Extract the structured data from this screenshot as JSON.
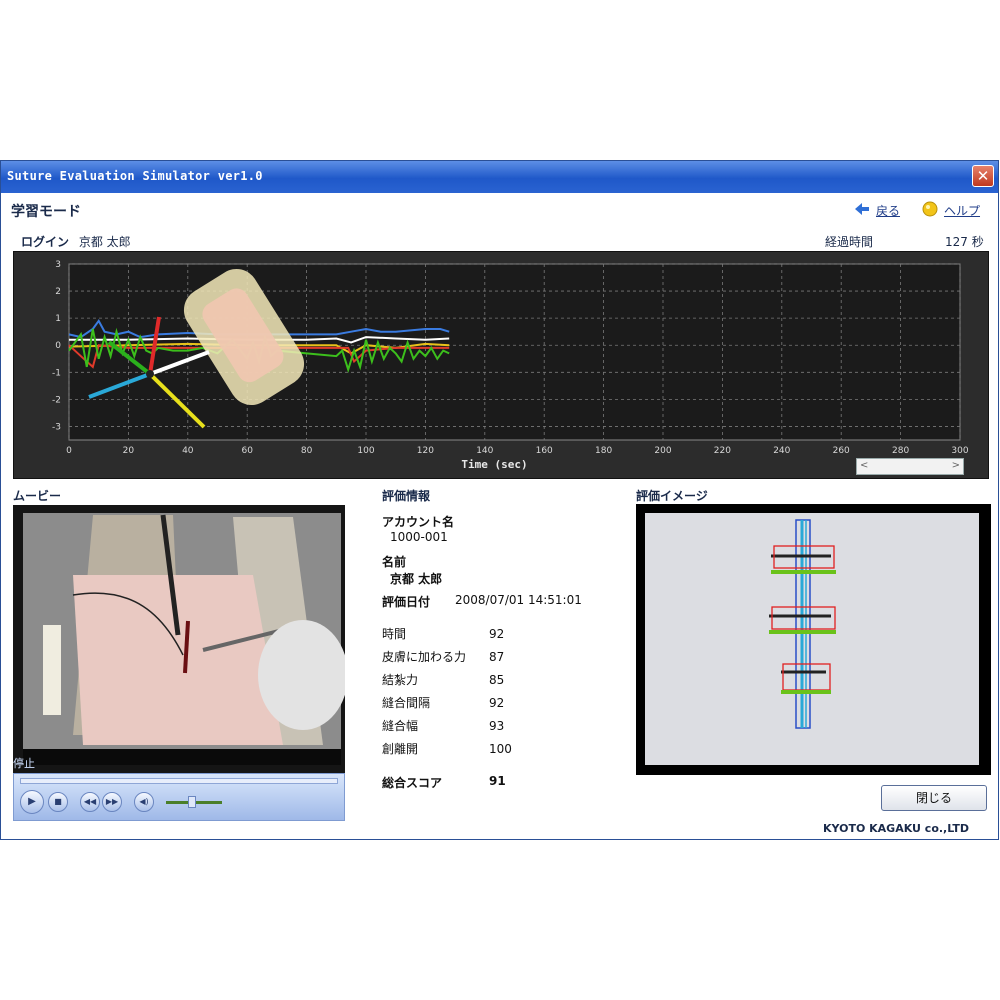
{
  "window": {
    "title": "Suture Evaluation Simulator ver1.0",
    "close_glyph": "✕"
  },
  "header": {
    "mode": "学習モード",
    "back_label": "戻る",
    "help_label": "ヘルプ"
  },
  "login": {
    "label": "ログイン",
    "user": "京都 太郎"
  },
  "elapsed": {
    "label": "経過時間",
    "value": "127 秒"
  },
  "chart_data": {
    "type": "line",
    "xlabel": "Time (sec)",
    "xlim": [
      0,
      300
    ],
    "ylim": [
      -3.5,
      3
    ],
    "xticks": [
      "0",
      "20",
      "40",
      "60",
      "80",
      "100",
      "120",
      "140",
      "160",
      "180",
      "200",
      "220",
      "240",
      "260",
      "280",
      "300"
    ],
    "yticks": [
      "3",
      "2",
      "1",
      "0",
      "-1",
      "-2",
      "-3"
    ],
    "grid": true,
    "series": [
      {
        "color": "#3a7be0",
        "x": [
          0,
          4,
          8,
          10,
          12,
          16,
          20,
          24,
          30,
          40,
          50,
          60,
          70,
          80,
          90,
          95,
          100,
          105,
          110,
          120,
          125,
          128
        ],
        "y": [
          0.4,
          0.3,
          0.6,
          0.9,
          0.5,
          0.4,
          0.5,
          0.3,
          0.4,
          0.45,
          0.4,
          0.4,
          0.4,
          0.4,
          0.4,
          0.5,
          0.6,
          0.5,
          0.5,
          0.6,
          0.6,
          0.5
        ]
      },
      {
        "color": "#ffffff",
        "x": [
          0,
          20,
          40,
          60,
          80,
          90,
          95,
          100,
          110,
          120,
          128
        ],
        "y": [
          0.2,
          0.2,
          0.25,
          0.2,
          0.2,
          0.25,
          0.1,
          0.3,
          0.25,
          0.2,
          0.25
        ]
      },
      {
        "color": "#e8c21a",
        "x": [
          0,
          20,
          40,
          60,
          80,
          90,
          95,
          100,
          110,
          120,
          128
        ],
        "y": [
          -0.05,
          0,
          0.05,
          0,
          0,
          0,
          -0.3,
          0,
          -0.1,
          0.05,
          0
        ]
      },
      {
        "color": "#e03a2a",
        "x": [
          0,
          5,
          8,
          10,
          20,
          40,
          60,
          80,
          94,
          96,
          100,
          110,
          120,
          128
        ],
        "y": [
          0,
          -0.5,
          -0.8,
          0,
          -0.1,
          -0.1,
          -0.1,
          -0.1,
          -0.1,
          -0.6,
          -0.2,
          -0.1,
          -0.1,
          -0.1
        ]
      },
      {
        "color": "#3cbf1c",
        "x": [
          0,
          4,
          6,
          8,
          10,
          12,
          14,
          16,
          18,
          20,
          22,
          24,
          26,
          28,
          30,
          35,
          40,
          45,
          50,
          55,
          60,
          62,
          64,
          66,
          68,
          70,
          80,
          90,
          92,
          94,
          96,
          98,
          100,
          102,
          104,
          106,
          108,
          110,
          112,
          114,
          116,
          118,
          120,
          122,
          124,
          126,
          128
        ],
        "y": [
          -0.2,
          0.4,
          -0.8,
          0.6,
          -0.5,
          0.3,
          -0.4,
          0.5,
          -0.3,
          0.2,
          -0.4,
          0.3,
          -0.2,
          -0.3,
          -0.1,
          -0.2,
          -0.2,
          -0.1,
          -0.3,
          0.2,
          -0.5,
          0.1,
          -0.6,
          0.3,
          -0.4,
          -0.2,
          -0.3,
          -0.4,
          -0.2,
          -0.9,
          -0.2,
          -0.8,
          0.2,
          -0.6,
          0.1,
          -0.5,
          -0.1,
          -0.3,
          -0.6,
          0.1,
          -0.5,
          -0.2,
          -0.4,
          -0.1,
          -0.5,
          -0.2,
          -0.3
        ]
      }
    ]
  },
  "movie": {
    "label": "ムービー",
    "status": "停止"
  },
  "evaluation": {
    "section_label": "評価情報",
    "account_label": "アカウント名",
    "account_value": "1000-001",
    "name_label": "名前",
    "name_value": "京都 太郎",
    "date_label": "評価日付",
    "date_value": "2008/07/01 14:51:01",
    "scores": [
      {
        "label": "時間",
        "value": "92"
      },
      {
        "label": "皮膚に加わる力",
        "value": "87"
      },
      {
        "label": "結紮力",
        "value": "85"
      },
      {
        "label": "縫合間隔",
        "value": "92"
      },
      {
        "label": "縫合幅",
        "value": "93"
      },
      {
        "label": "創離開",
        "value": "100"
      }
    ],
    "total_label": "総合スコア",
    "total_value": "91"
  },
  "eval_image": {
    "label": "評価イメージ"
  },
  "close_button": {
    "label": "閉じる"
  },
  "footer": {
    "company": "KYOTO KAGAKU co.,LTD"
  }
}
